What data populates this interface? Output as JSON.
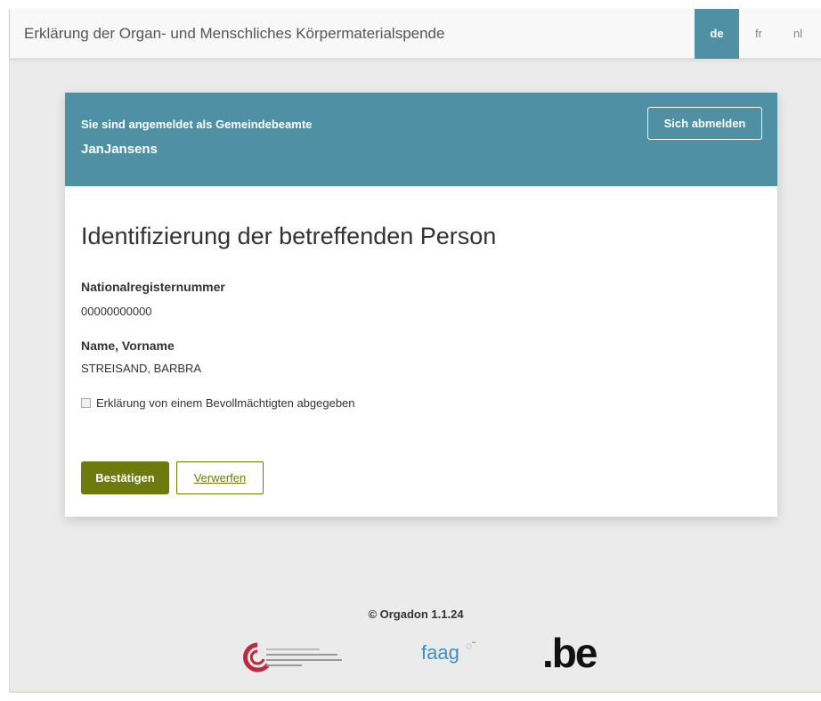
{
  "app": {
    "title": "Erklärung der Organ- und Menschliches Körpermaterialspende"
  },
  "languages": [
    {
      "code": "de",
      "active": true
    },
    {
      "code": "fr",
      "active": false
    },
    {
      "code": "nl",
      "active": false
    }
  ],
  "header": {
    "logged_in_text": "Sie sind angemeldet als Gemeindebeamte",
    "username": "JanJansens",
    "logout_label": "Sich abmelden"
  },
  "form": {
    "title": "Identifizierung der betreffenden Person",
    "national_register_label": "Nationalregisternummer",
    "national_register_value": "00000000000",
    "name_label": "Name, Vorname",
    "name_value": "STREISAND, BARBRA",
    "proxy_checkbox_label": "Erklärung von einem Bevollmächtigten abgegeben",
    "proxy_checked": false,
    "confirm_label": "Bestätigen",
    "discard_label": "Verwerfen"
  },
  "footer": {
    "copyright": "© Orgadon 1.1.24",
    "logos": [
      "fps-health-logo",
      "faag-logo",
      "be-logo"
    ],
    "faag_text": "faag",
    "be_text": ".be"
  },
  "colors": {
    "header_bg": "#4f90a4",
    "primary_button": "#6d7a0c",
    "page_bg": "#ebebeb"
  }
}
